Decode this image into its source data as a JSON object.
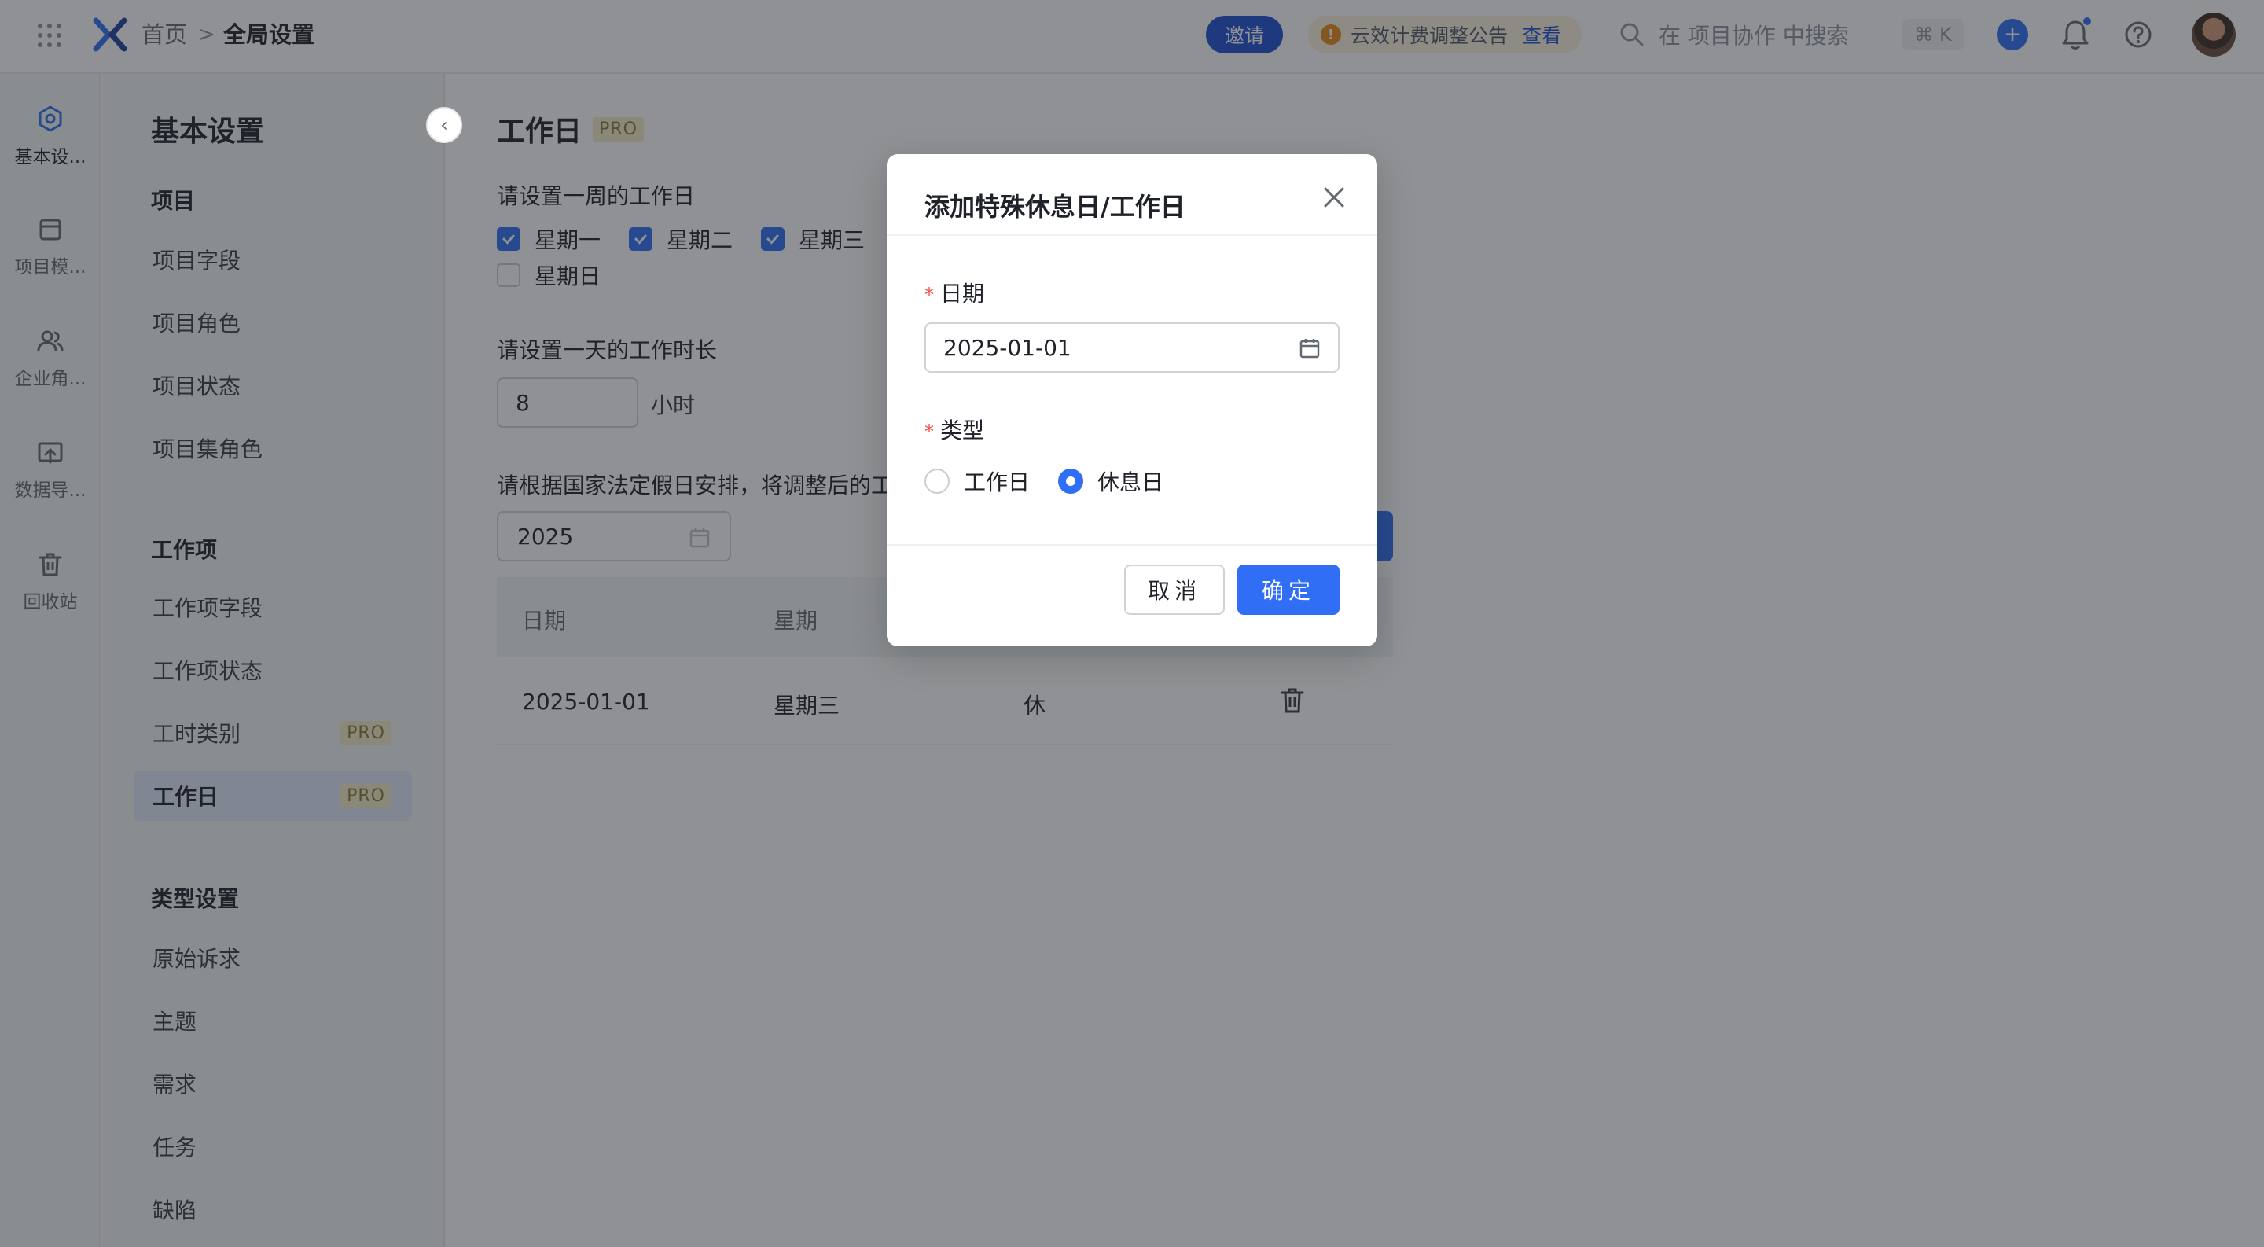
{
  "topbar": {
    "breadcrumb_home": "首页",
    "breadcrumb_sep": ">",
    "breadcrumb_current": "全局设置",
    "invite_label": "邀请",
    "notice_text": "云效计费调整公告",
    "notice_link": "查看",
    "search_placeholder": "在 项目协作 中搜索",
    "shortcut": "⌘ K"
  },
  "rail": {
    "items": [
      {
        "label": "基本设...",
        "icon": "settings-hex-icon",
        "active": true
      },
      {
        "label": "项目模...",
        "icon": "template-icon",
        "active": false
      },
      {
        "label": "企业角...",
        "icon": "users-icon",
        "active": false
      },
      {
        "label": "数据导...",
        "icon": "import-icon",
        "active": false
      },
      {
        "label": "回收站",
        "icon": "trash-icon",
        "active": false
      }
    ]
  },
  "subnav": {
    "title": "基本设置",
    "groups": [
      {
        "title": "项目",
        "items": [
          "项目字段",
          "项目角色",
          "项目状态",
          "项目集角色"
        ]
      },
      {
        "title": "工作项",
        "items": [
          "工作项字段",
          "工作项状态",
          "工时类别",
          "工作日"
        ]
      },
      {
        "title": "类型设置",
        "items": [
          "原始诉求",
          "主题",
          "需求",
          "任务",
          "缺陷"
        ]
      }
    ],
    "pro_badge": "PRO"
  },
  "main": {
    "title": "工作日",
    "pro_badge": "PRO",
    "week_label": "请设置一周的工作日",
    "weekdays": [
      {
        "label": "星期一",
        "checked": true
      },
      {
        "label": "星期二",
        "checked": true
      },
      {
        "label": "星期三",
        "checked": true
      },
      {
        "label": "星期日",
        "checked": false
      }
    ],
    "hours_label": "请设置一天的工作时长",
    "hours_value": "8",
    "hours_unit": "小时",
    "holiday_label": "请根据国家法定假日安排，将调整后的工",
    "year_value": "2025",
    "table": {
      "headers": [
        "日期",
        "星期"
      ],
      "rows": [
        {
          "date": "2025-01-01",
          "weekday": "星期三",
          "type": "休"
        }
      ]
    }
  },
  "modal": {
    "title": "添加特殊休息日/工作日",
    "required_mark": "*",
    "date_label": "日期",
    "date_value": "2025-01-01",
    "type_label": "类型",
    "type_options": [
      {
        "label": "工作日",
        "selected": false
      },
      {
        "label": "休息日",
        "selected": true
      }
    ],
    "cancel_label": "取消",
    "ok_label": "确定"
  },
  "colors": {
    "accent": "#2f6ef5",
    "invite_bg": "#1e4fd3",
    "notice_bg": "#fdf0df",
    "warn": "#e88a16",
    "required": "#f54a45",
    "active_nav_bg": "#e1e9fb"
  }
}
